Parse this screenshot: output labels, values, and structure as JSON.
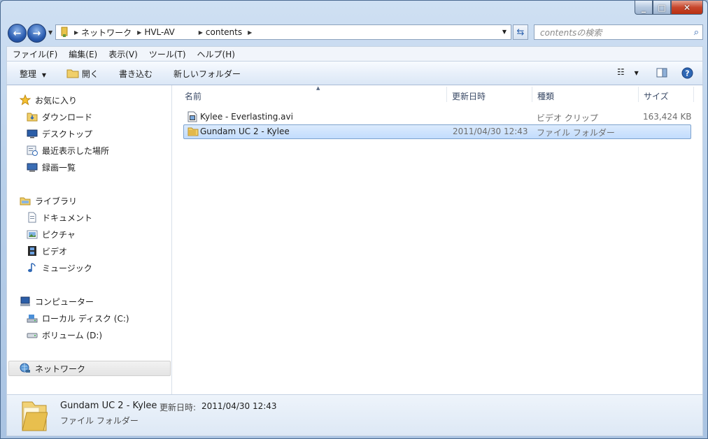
{
  "window": {
    "caption_minimize": "_",
    "caption_maximize": "□",
    "caption_close": "✕"
  },
  "nav": {
    "back_label": "←",
    "forward_label": "→",
    "breadcrumb": [
      "ネットワーク",
      "HVL-AV",
      "contents"
    ],
    "search_placeholder": "contentsの検索"
  },
  "menu": [
    "ファイル(F)",
    "編集(E)",
    "表示(V)",
    "ツール(T)",
    "ヘルプ(H)"
  ],
  "toolbar": {
    "organize": "整理",
    "open": "開く",
    "burn": "書き込む",
    "new_folder": "新しいフォルダー"
  },
  "navpane": {
    "favorites": "お気に入り",
    "favorites_items": [
      "ダウンロード",
      "デスクトップ",
      "最近表示した場所",
      "録画一覧"
    ],
    "libraries": "ライブラリ",
    "libraries_items": [
      "ドキュメント",
      "ピクチャ",
      "ビデオ",
      "ミュージック"
    ],
    "computer": "コンピューター",
    "computer_items": [
      "ローカル ディスク (C:)",
      "ボリューム (D:)"
    ],
    "network": "ネットワーク"
  },
  "columns": {
    "name": "名前",
    "date": "更新日時",
    "type": "種類",
    "size": "サイズ"
  },
  "files": [
    {
      "name": "Kylee - Everlasting.avi",
      "date": "",
      "type": "ビデオ クリップ",
      "size": "163,424 KB"
    },
    {
      "name": "Gundam UC 2 - Kylee",
      "date": "2011/04/30 12:43",
      "type": "ファイル フォルダー",
      "size": ""
    }
  ],
  "details": {
    "name": "Gundam UC 2 - Kylee",
    "date_label": "更新日時:",
    "date_value": "2011/04/30 12:43",
    "type": "ファイル フォルダー"
  },
  "colors": {
    "selection": "#c2dcfd",
    "accent": "#2b61ad",
    "close": "#c8462c"
  }
}
